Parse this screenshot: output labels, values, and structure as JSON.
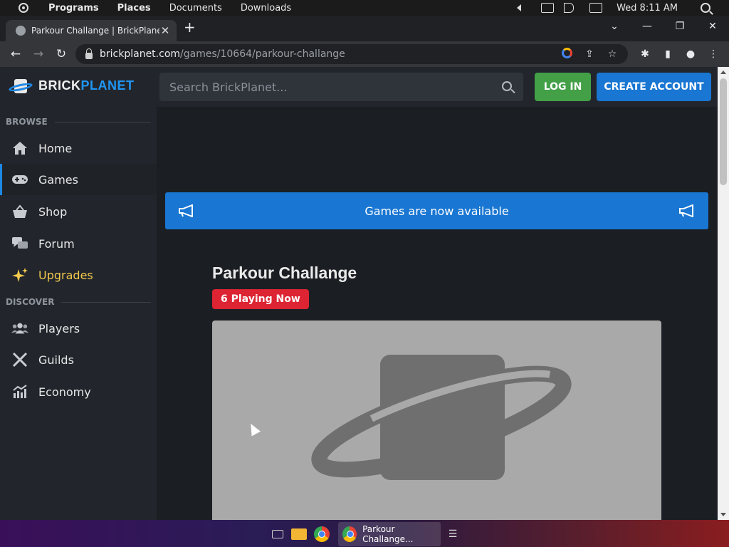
{
  "system_bar": {
    "menus": [
      "Programs",
      "Places",
      "Documents",
      "Downloads"
    ],
    "clock": "Wed 8:11 AM"
  },
  "browser": {
    "tab_title": "Parkour Challange | BrickPlanet",
    "tab_close": "✕",
    "new_tab": "+",
    "window_controls": [
      "⌄",
      "—",
      "❐",
      "✕"
    ],
    "nav": {
      "back": "←",
      "forward": "→",
      "reload": "↻"
    },
    "url_host": "brickplanet.com",
    "url_path": "/games/10664/parkour-challange",
    "omnibox_tools": {
      "share": "⇪",
      "star": "☆"
    },
    "extensions": {
      "puzzle": "✱",
      "sidepanel": "▮",
      "profile": "●",
      "menu": "⋮"
    }
  },
  "site": {
    "logo": {
      "part1": "BRICK",
      "part2": "PLANET"
    },
    "search_placeholder": "Search BrickPlanet...",
    "login_label": "LOG IN",
    "create_account_label": "CREATE ACCOUNT",
    "accent_color": "#1976d2",
    "login_color": "#43a047"
  },
  "sidebar": {
    "browse_label": "BROWSE",
    "discover_label": "DISCOVER",
    "browse_items": [
      {
        "label": "Home",
        "icon": "home-icon"
      },
      {
        "label": "Games",
        "icon": "gamepad-icon"
      },
      {
        "label": "Shop",
        "icon": "basket-icon"
      },
      {
        "label": "Forum",
        "icon": "comments-icon"
      },
      {
        "label": "Upgrades",
        "icon": "sparkles-icon"
      }
    ],
    "discover_items": [
      {
        "label": "Players",
        "icon": "users-icon"
      },
      {
        "label": "Guilds",
        "icon": "swords-icon"
      },
      {
        "label": "Economy",
        "icon": "chart-icon"
      }
    ],
    "active_item": "Games"
  },
  "main": {
    "banner_text": "Games are now available",
    "game_title": "Parkour Challange",
    "playing_badge": "6 Playing Now",
    "badge_color": "#dc2433"
  },
  "taskbar": {
    "window_label": "Parkour Challange...",
    "menu_glyph": "☰"
  }
}
